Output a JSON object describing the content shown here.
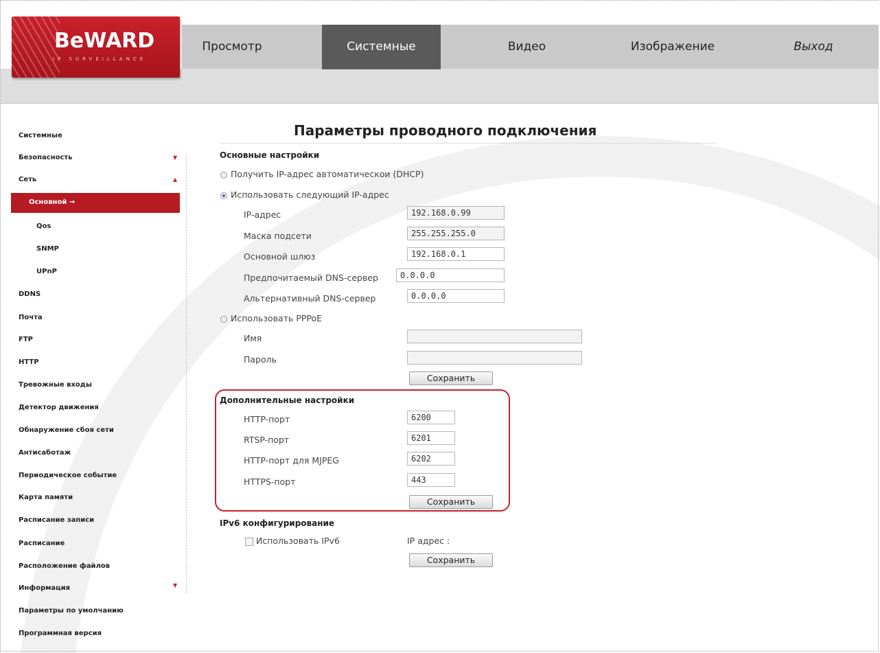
{
  "brand": {
    "name": "BeWARD",
    "tagline": "IP SURVEILLANCE",
    "accent": "#c8212b"
  },
  "nav": [
    {
      "label": "Просмотр",
      "active": false
    },
    {
      "label": "Системные",
      "active": true
    },
    {
      "label": "Видео",
      "active": false
    },
    {
      "label": "Изображение",
      "active": false
    },
    {
      "label": "Выход",
      "active": false
    }
  ],
  "sidebar": {
    "items": [
      {
        "label": "Системные"
      },
      {
        "label": "Безопасность",
        "arrow": "▼"
      },
      {
        "label": "Сеть",
        "arrow": "▲"
      },
      {
        "label": "Основной",
        "active": true,
        "suffix": "→"
      },
      {
        "label": "Qos"
      },
      {
        "label": "SNMP"
      },
      {
        "label": "UPnP"
      },
      {
        "label": "DDNS"
      },
      {
        "label": "Почта"
      },
      {
        "label": "FTP"
      },
      {
        "label": "HTTP"
      },
      {
        "label": "Тревожные входы"
      },
      {
        "label": "Детектор движения"
      },
      {
        "label": "Обнаружение сбоя сети"
      },
      {
        "label": "Антисаботаж"
      },
      {
        "label": "Периодическое событие"
      },
      {
        "label": "Карта памяти"
      },
      {
        "label": "Расписание записи"
      },
      {
        "label": "Расписание"
      },
      {
        "label": "Расположение файлов"
      },
      {
        "label": "Информация",
        "arrow": "▼"
      },
      {
        "label": "Параметры по умолчанию"
      },
      {
        "label": "Программная версия"
      }
    ]
  },
  "main": {
    "title": "Параметры проводного подключения",
    "basic": {
      "title": "Основные настройки",
      "dhcp_label": "Получить IP-адрес автоматическои (DHCP)",
      "static_label": "Использовать следующий IP-адрес",
      "fields": [
        {
          "label": "IP-адрес",
          "value": "192.168.0.99"
        },
        {
          "label": "Маска подсети",
          "value": "255.255.255.0"
        },
        {
          "label": "Основной шлюз",
          "value": "192.168.0.1"
        },
        {
          "label": "Предпочитаемый DNS-сервер",
          "value": "0.0.0.0"
        },
        {
          "label": "Альтернативный DNS-сервер",
          "value": "0.0.0.0"
        }
      ],
      "pppoe_label": "Использовать PPPoE",
      "pppoe_name_label": "Имя",
      "pppoe_name_value": "",
      "pppoe_pass_label": "Пароль",
      "pppoe_pass_value": "",
      "save_label": "Сохранить"
    },
    "advanced": {
      "title": "Дополнительные настройки",
      "fields": [
        {
          "label": "HTTP-порт",
          "value": "6200"
        },
        {
          "label": "RTSP-порт",
          "value": "6201"
        },
        {
          "label": "HTTP-порт для MJPEG",
          "value": "6202"
        },
        {
          "label": "HTTPS-порт",
          "value": "443"
        }
      ],
      "save_label": "Сохранить"
    },
    "ipv6": {
      "title": "IPv6 конфигурирование",
      "checkbox_label": "Использовать IPv6",
      "ip_label": "IP адрес :",
      "save_label": "Сохранить"
    }
  }
}
